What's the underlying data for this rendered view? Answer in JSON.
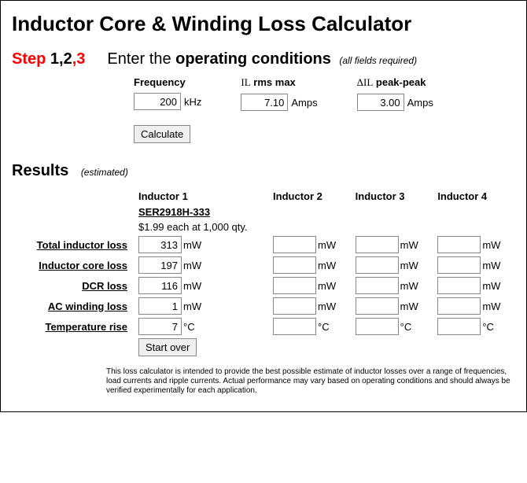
{
  "title": "Inductor Core & Winding Loss Calculator",
  "step": {
    "prefix": "Step",
    "n1": " 1",
    "n2": ",2",
    "n3": ",3",
    "enter_prefix": "Enter the ",
    "enter_bold": "operating conditions",
    "note": "(all fields required)"
  },
  "inputs": {
    "freq": {
      "label": "Frequency",
      "value": "200",
      "unit": "kHz"
    },
    "il": {
      "label_pre": "I",
      "label_sub": "L",
      "label_post": " rms max",
      "value": "7.10",
      "unit": "Amps"
    },
    "dil": {
      "label_pre": "ΔI",
      "label_sub": "L",
      "label_post": " peak-peak",
      "value": "3.00",
      "unit": "Amps"
    }
  },
  "buttons": {
    "calculate": "Calculate",
    "start_over": "Start over"
  },
  "results": {
    "heading": "Results",
    "note": "(estimated)",
    "inductors": [
      {
        "header": "Inductor 1",
        "part": "SER2918H-333",
        "price": "$1.99 each at 1,000 qty.",
        "total": "313",
        "core": "197",
        "dcr": "116",
        "ac": "1",
        "temp": "7"
      },
      {
        "header": "Inductor 2",
        "part": "",
        "price": "",
        "total": "",
        "core": "",
        "dcr": "",
        "ac": "",
        "temp": ""
      },
      {
        "header": "Inductor 3",
        "part": "",
        "price": "",
        "total": "",
        "core": "",
        "dcr": "",
        "ac": "",
        "temp": ""
      },
      {
        "header": "Inductor 4",
        "part": "",
        "price": "",
        "total": "",
        "core": "",
        "dcr": "",
        "ac": "",
        "temp": ""
      }
    ],
    "row_labels": {
      "total": "Total inductor loss",
      "core": "Inductor core loss",
      "dcr": "DCR loss",
      "ac": "AC winding loss",
      "temp": "Temperature rise"
    },
    "units": {
      "power": "mW",
      "temp": "°C"
    }
  },
  "disclaimer": "This loss calculator is intended to provide the best possible estimate of inductor losses over a range of frequencies, load currents and ripple currents. Actual performance may vary based on operating conditions and should always be verified experimentally for each application."
}
